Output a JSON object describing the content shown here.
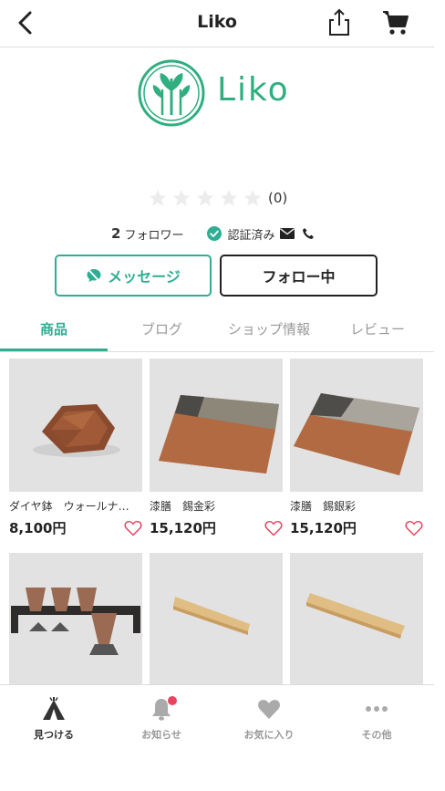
{
  "header": {
    "title": "Liko",
    "back_icon": "chevron-left-icon",
    "share_icon": "share-icon",
    "cart_icon": "cart-icon"
  },
  "shop": {
    "logo_text": "Liko",
    "brand_color": "#2fae7f",
    "rating_stars": 0,
    "rating_max": 5,
    "rating_count": "(0)",
    "follower_count": "2",
    "follower_label": "フォロワー",
    "verified_label": "認証済み"
  },
  "actions": {
    "message_label": "メッセージ",
    "follow_label": "フォロー中"
  },
  "tabs": [
    {
      "label": "商品",
      "active": true
    },
    {
      "label": "ブログ",
      "active": false
    },
    {
      "label": "ショップ情報",
      "active": false
    },
    {
      "label": "レビュー",
      "active": false
    }
  ],
  "products": [
    {
      "name": "ダイヤ鉢　ウォールナ…",
      "price": "8,100円"
    },
    {
      "name": "漆膳　錫金彩",
      "price": "15,120円"
    },
    {
      "name": "漆膳　錫銀彩",
      "price": "15,120円"
    },
    {
      "name": "",
      "price": ""
    },
    {
      "name": "",
      "price": ""
    },
    {
      "name": "",
      "price": ""
    }
  ],
  "bottom_nav": [
    {
      "label": "見つける",
      "icon": "tent-icon",
      "active": true
    },
    {
      "label": "お知らせ",
      "icon": "bell-icon",
      "active": false
    },
    {
      "label": "お気に入り",
      "icon": "heart-icon",
      "active": false
    },
    {
      "label": "その他",
      "icon": "more-dots-icon",
      "active": false
    }
  ],
  "colors": {
    "accent": "#2fae93",
    "notification_dot": "#e6445f",
    "heart_outline": "#e6445f"
  }
}
